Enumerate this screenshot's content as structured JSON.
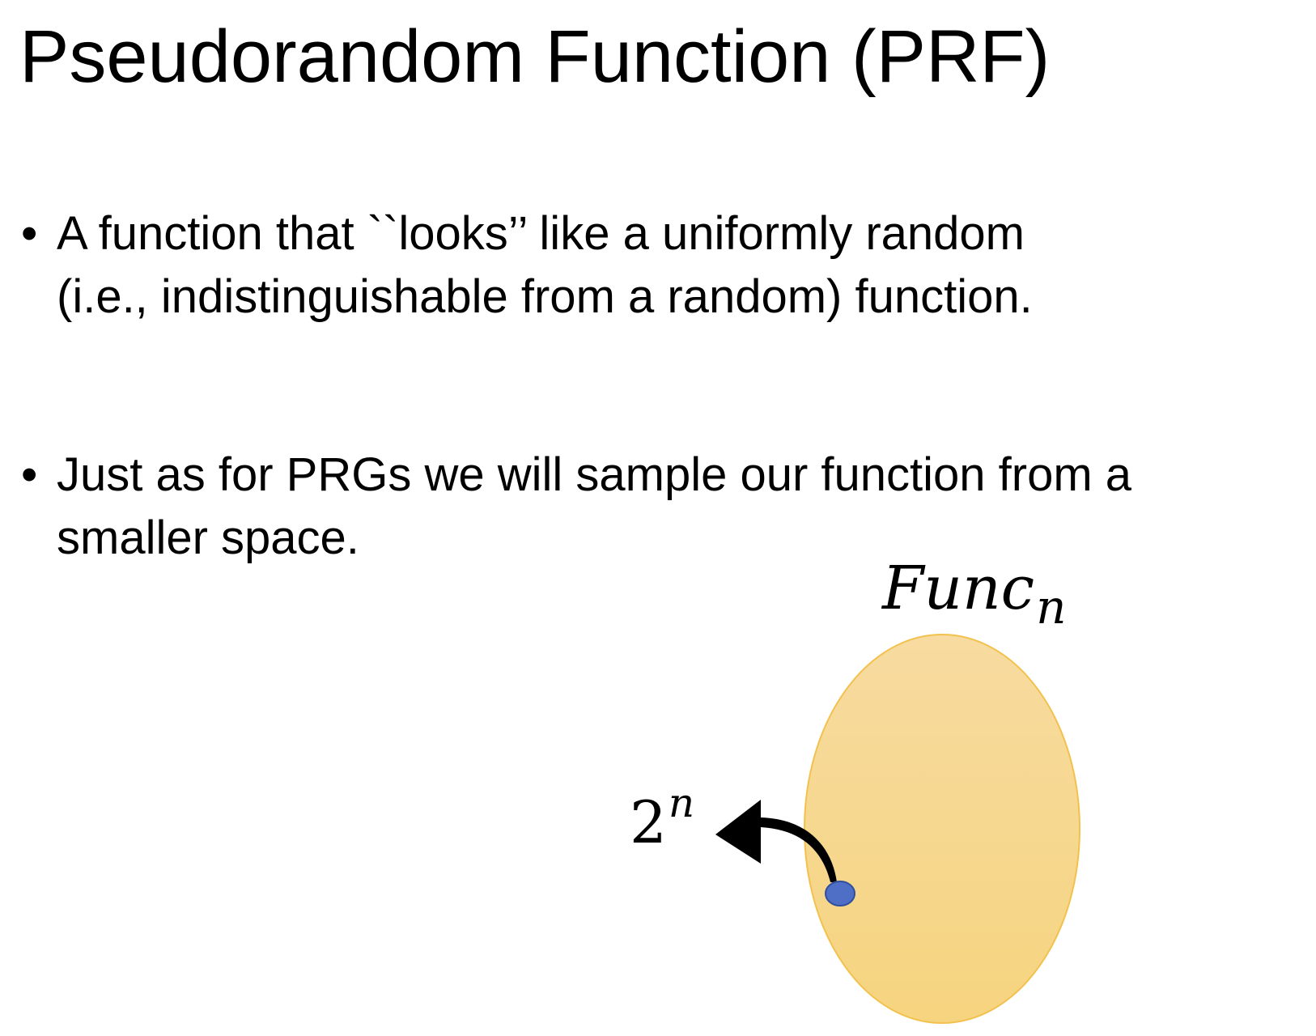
{
  "slide": {
    "title": "Pseudorandom Function (PRF)",
    "bullet_marker": "•",
    "bullets": [
      {
        "lines": [
          "A function that ``looks’’ like a uniformly random",
          "(i.e., indistinguishable from a random) function."
        ]
      },
      {
        "lines": [
          "Just as for PRGs we will sample our function from a",
          "smaller space."
        ]
      }
    ]
  },
  "diagram": {
    "set_label": {
      "base": "Func",
      "subscript": "n"
    },
    "subset_label": {
      "base": "2",
      "superscript": "n"
    },
    "colors": {
      "ellipse_fill_top": "#f7dba0",
      "ellipse_fill_bottom": "#f6d47f",
      "ellipse_stroke": "#f2c14e",
      "dot_fill": "#4f6fc6",
      "dot_stroke": "#2f4f9e",
      "arrow_fill": "#000000"
    }
  }
}
